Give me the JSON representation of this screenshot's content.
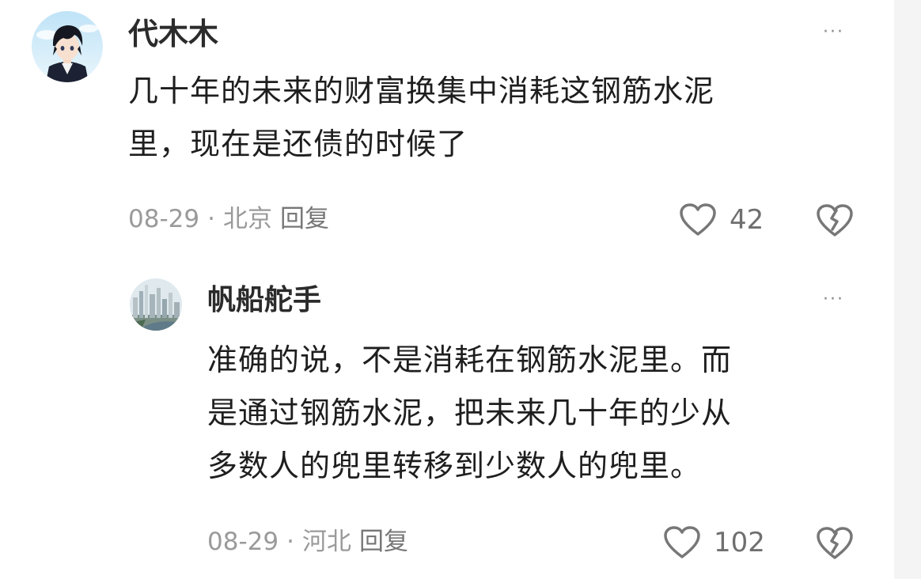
{
  "comments": [
    {
      "username": "代木木",
      "text_line1": "几十年的未来的财富换集中消耗这钢筋水泥",
      "text_line2": "里，现在是还债的时候了",
      "date": "08-29",
      "dot": "·",
      "location": "北京",
      "reply_label": "回复",
      "likes": "42",
      "more_label": "···"
    },
    {
      "username": "帆船舵手",
      "text_line1": "准确的说，不是消耗在钢筋水泥里。而",
      "text_line2": "是通过钢筋水泥，把未来几十年的少从",
      "text_line3": "多数人的兜里转移到少数人的兜里。",
      "date": "08-29",
      "dot": "·",
      "location": "河北",
      "reply_label": "回复",
      "likes": "102",
      "more_label": "···"
    }
  ],
  "colors": {
    "text": "#1e1e1e",
    "meta": "#9a9a9a",
    "icon": "#7a7a7a"
  }
}
